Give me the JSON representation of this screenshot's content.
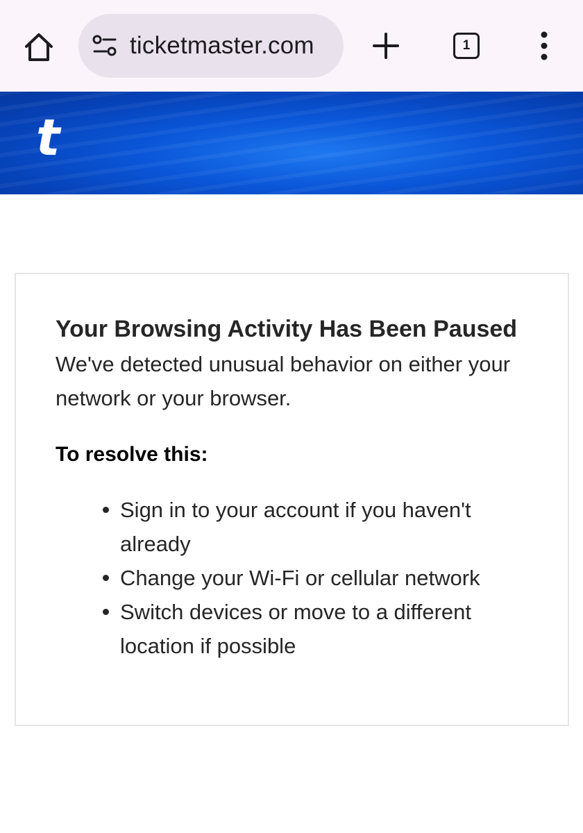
{
  "browser": {
    "url": "ticketmaster.com",
    "tab_count": "1",
    "icons": {
      "home": "home-icon",
      "site_settings": "tune-icon",
      "new_tab": "plus-icon",
      "tabs": "tab-switcher-icon",
      "menu": "more-vert-icon"
    },
    "colors": {
      "toolbar_bg": "#fbf4fb",
      "address_bg": "#e9e2ec"
    }
  },
  "banner": {
    "logo_text": "t",
    "color": "#0a56d8"
  },
  "message": {
    "heading": "Your Browsing Activity Has Been Paused",
    "intro": "We've detected unusual behavior on either your network or your browser.",
    "resolve_label": "To resolve this:",
    "steps": [
      "Sign in to your account if you haven't already",
      "Change your Wi-Fi or cellular network",
      "Switch devices or move to a different location if possible"
    ]
  }
}
